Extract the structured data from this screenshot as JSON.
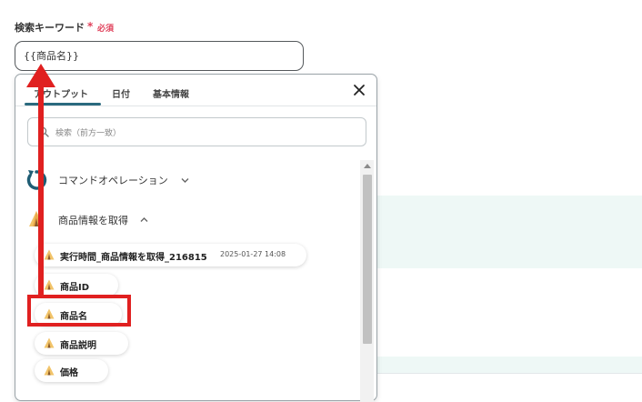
{
  "field": {
    "label": "検索キーワード",
    "required_mark": "*",
    "required_text": "必須",
    "value": "{{商品名}}"
  },
  "tabs": [
    {
      "label": "アウトプット",
      "active": true
    },
    {
      "label": "日付",
      "active": false
    },
    {
      "label": "基本情報",
      "active": false
    }
  ],
  "filter": {
    "placeholder": "検索（前方一致）"
  },
  "groups": [
    {
      "label": "コマンドオペレーション",
      "icon": "refresh-icon",
      "expanded": false
    },
    {
      "label": "商品情報を取得",
      "icon": "store-tent-icon",
      "expanded": true
    }
  ],
  "chips": [
    {
      "label": "実行時間_商品情報を取得_216815",
      "date": "2025-01-27 14:08"
    },
    {
      "label": "商品ID"
    },
    {
      "label": "商品名"
    },
    {
      "label": "商品説明"
    },
    {
      "label": "価格"
    }
  ],
  "colors": {
    "accent": "#2a6a7e",
    "required": "#e0405a",
    "annotation": "#e02020"
  }
}
